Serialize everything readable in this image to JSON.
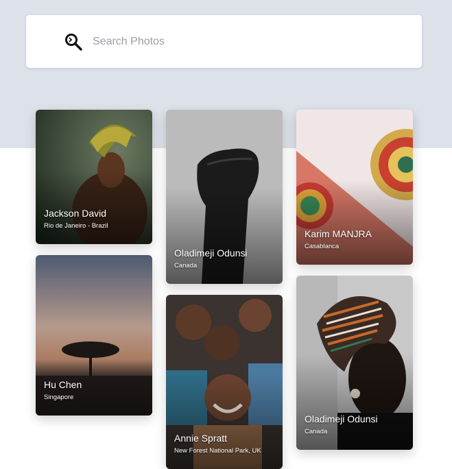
{
  "search": {
    "placeholder": "Search Photos",
    "icon": "search-icon"
  },
  "photos": [
    {
      "name": "Jackson David",
      "location": "Rio de Janeiro - Brazil"
    },
    {
      "name": "Hu Chen",
      "location": "Singapore"
    },
    {
      "name": "Oladimeji Odunsi",
      "location": "Canada"
    },
    {
      "name": "Annie Spratt",
      "location": "New Forest National Park, UK"
    },
    {
      "name": "Karim MANJRA",
      "location": "Casablanca"
    },
    {
      "name": "Oladimeji Odunsi",
      "location": "Canada"
    }
  ]
}
